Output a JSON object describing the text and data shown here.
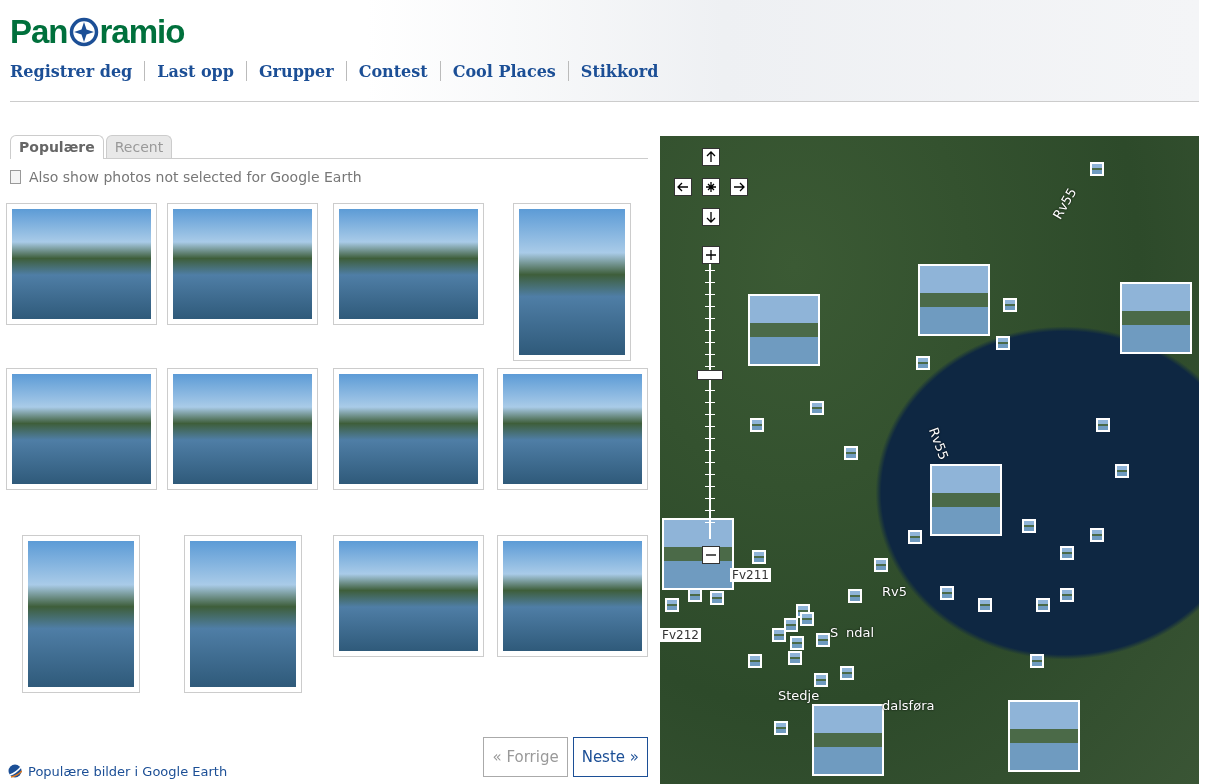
{
  "logo": {
    "text": "Pan",
    "text_after": "ramio"
  },
  "nav": [
    "Registrer deg",
    "Last opp",
    "Grupper",
    "Contest",
    "Cool Places",
    "Stikkord"
  ],
  "tabs": [
    {
      "label": "Populære",
      "selected": true
    },
    {
      "label": "Recent",
      "selected": false
    }
  ],
  "filter": {
    "label": "Also show photos not selected for Google Earth",
    "checked": false
  },
  "photos": [
    {
      "kind": "landscape"
    },
    {
      "kind": "landscape"
    },
    {
      "kind": "landscape"
    },
    {
      "kind": "portrait"
    },
    {
      "kind": "landscape"
    },
    {
      "kind": "landscape"
    },
    {
      "kind": "landscape"
    },
    {
      "kind": "landscape"
    },
    {
      "kind": "portrait"
    },
    {
      "kind": "portrait"
    },
    {
      "kind": "landscape"
    },
    {
      "kind": "landscape"
    }
  ],
  "earth_link": "Populære bilder i Google Earth",
  "pager": [
    {
      "label": "« Forrige",
      "disabled": true
    },
    {
      "label": "Neste »",
      "disabled": false
    }
  ],
  "map": {
    "zoom": {
      "level": 0.6
    },
    "labels": [
      "Rv55",
      "Rv55",
      "Fv211",
      "Fv212",
      "Rv5",
      "S",
      "ndal",
      "Stedje",
      "dalsføra"
    ]
  }
}
